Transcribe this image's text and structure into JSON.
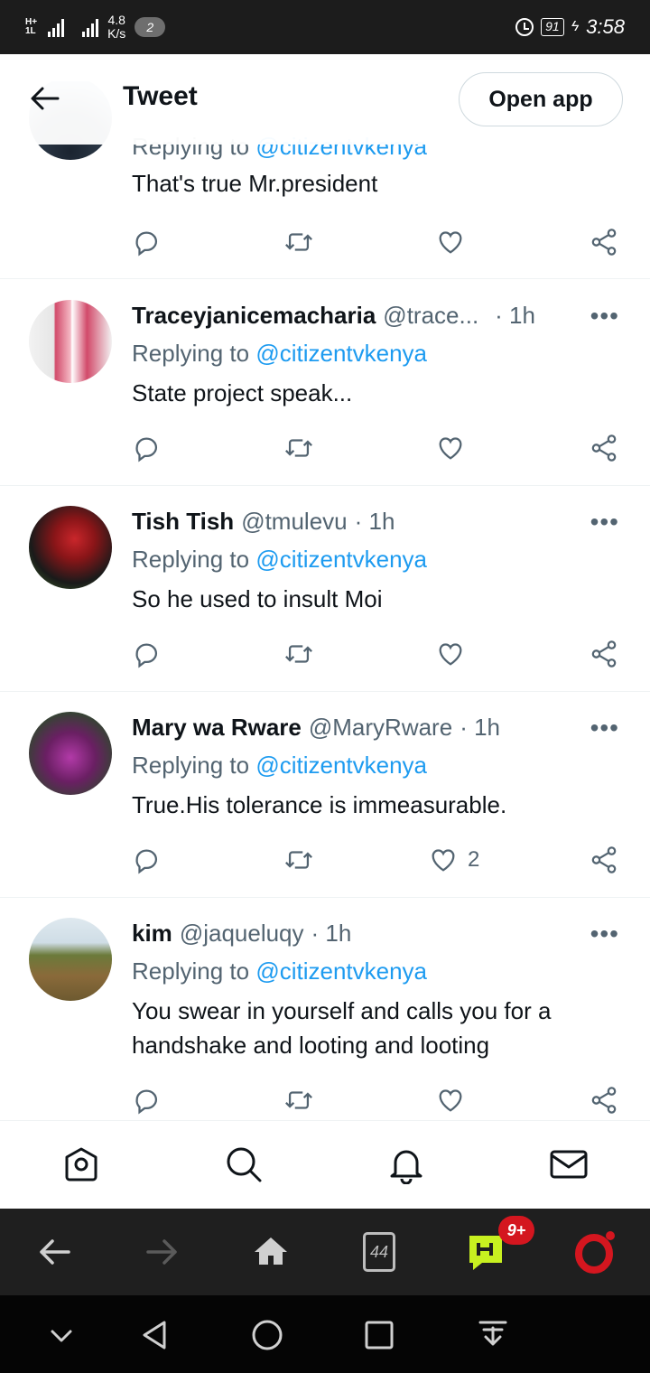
{
  "status_bar": {
    "network_tag": "H+",
    "network_tag2": "1L",
    "speed_value": "4.8",
    "speed_unit": "K/s",
    "notification_count": "2",
    "battery": "91",
    "time": "3:58"
  },
  "header": {
    "title": "Tweet",
    "open_app_label": "Open app"
  },
  "tweets": [
    {
      "name": "",
      "handle": "",
      "time": "",
      "replying_prefix": "Replying to",
      "replying_to": "@citizentvkenya",
      "text": "That's true Mr.president",
      "likes": ""
    },
    {
      "name": "Traceyjanicemacharia",
      "handle": "@trace...",
      "time": "· 1h",
      "replying_prefix": "Replying to",
      "replying_to": "@citizentvkenya",
      "text": "State project speak...",
      "likes": ""
    },
    {
      "name": "Tish Tish",
      "handle": "@tmulevu",
      "time": "· 1h",
      "replying_prefix": "Replying to",
      "replying_to": "@citizentvkenya",
      "text": "So he used to insult Moi",
      "likes": ""
    },
    {
      "name": "Mary wa Rware",
      "handle": "@MaryRware",
      "time": "· 1h",
      "replying_prefix": "Replying to",
      "replying_to": "@citizentvkenya",
      "text": "True.His tolerance is immeasurable.",
      "likes": "2"
    },
    {
      "name": "kim",
      "handle": "@jaqueluqy",
      "time": "· 1h",
      "replying_prefix": "Replying to",
      "replying_to": "@citizentvkenya",
      "text": "You swear in yourself and calls you for a handshake and looting and looting",
      "likes": ""
    }
  ],
  "more_label": "•••",
  "browser_bar": {
    "tabs_count": "44",
    "hub_badge": "9+"
  },
  "icons": {
    "back": "back-arrow-icon",
    "reply": "reply-icon",
    "retweet": "retweet-icon",
    "like": "heart-icon",
    "share": "share-icon",
    "home": "home-icon",
    "search": "search-icon",
    "notifications": "bell-icon",
    "messages": "mail-icon"
  },
  "colors": {
    "accent": "#1d9bf0",
    "secondary_text": "#536471",
    "primary_text": "#0f1419",
    "opera_red": "#d4161f",
    "hub_green": "#c8f020"
  }
}
